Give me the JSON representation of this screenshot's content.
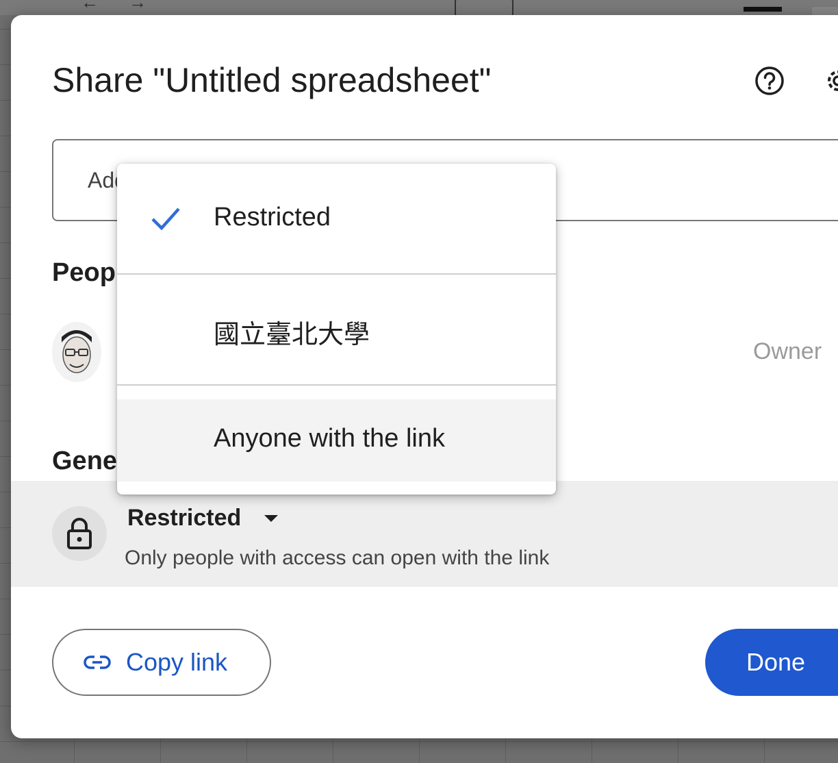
{
  "dialog": {
    "title": "Share \"Untitled spreadsheet\"",
    "add_people_placeholder": "Add people, groups, and calendar events",
    "people_heading": "People with access",
    "owner_role": "Owner",
    "general_heading": "General access",
    "access": {
      "selected": "Restricted",
      "description": "Only people with access can open with the link"
    },
    "copy_link_label": "Copy link",
    "done_label": "Done"
  },
  "access_menu": {
    "items": [
      {
        "label": "Restricted",
        "checked": true
      },
      {
        "label": "國立臺北大學",
        "checked": false
      },
      {
        "label": "Anyone with the link",
        "checked": false,
        "hovered": true
      }
    ]
  },
  "colors": {
    "accent_blue": "#1f58cf",
    "link_blue": "#1a56c4",
    "check_blue": "#2f6ed8",
    "general_row_bg": "#eeeeee"
  },
  "icons": [
    "help-icon",
    "gear-icon",
    "check-icon",
    "lock-icon",
    "link-icon",
    "chevron-down-icon"
  ]
}
